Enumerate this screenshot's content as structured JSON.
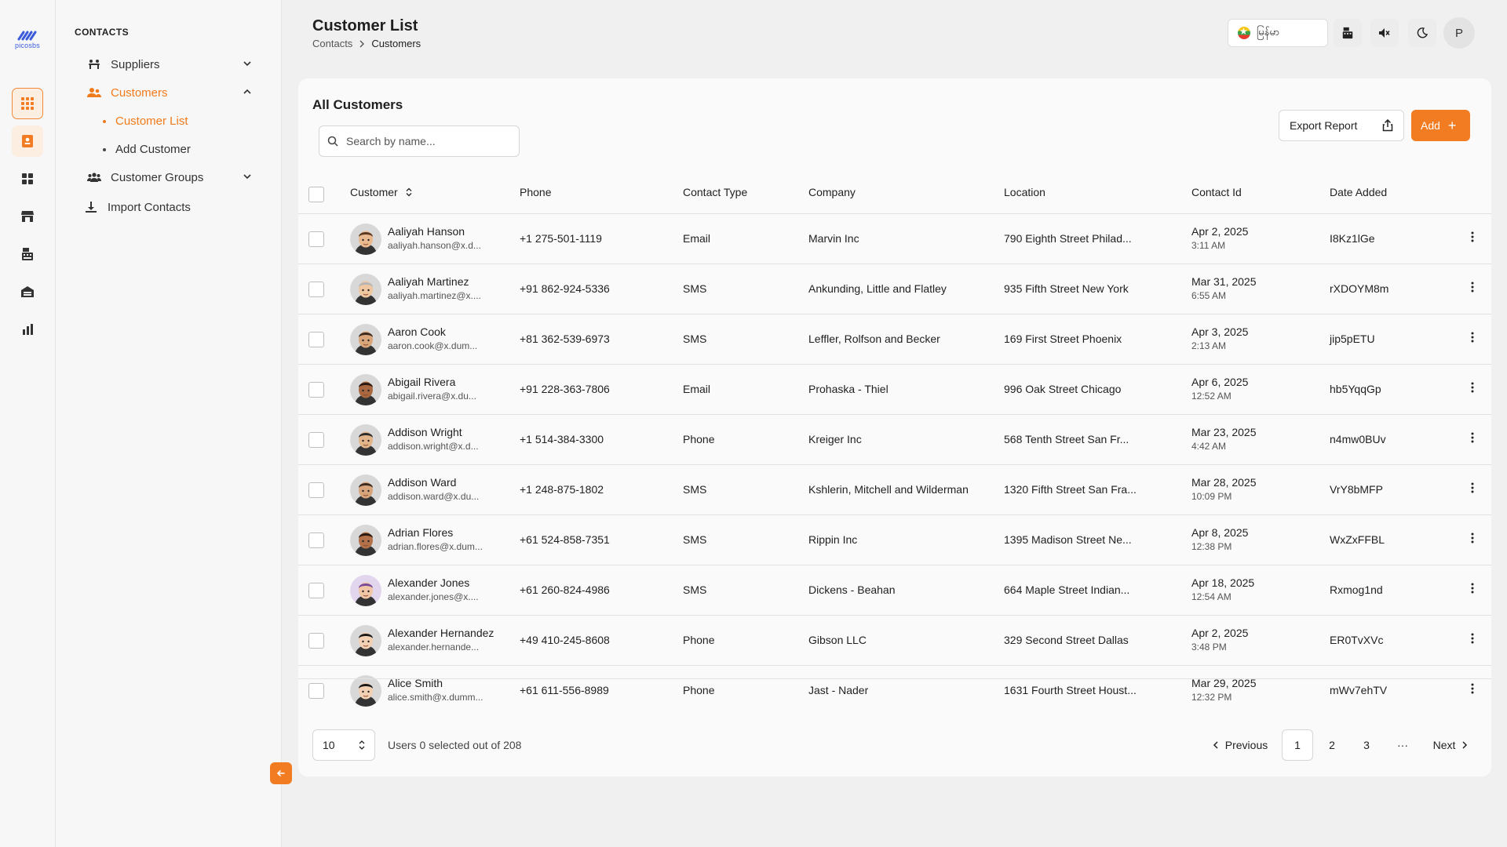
{
  "brand": {
    "logo_text": "picosbs"
  },
  "rail": {
    "items": [
      {
        "name": "grid",
        "icon": "grid-icon"
      },
      {
        "name": "contacts",
        "icon": "contact-card-icon"
      },
      {
        "name": "widgets",
        "icon": "widgets-icon"
      },
      {
        "name": "store",
        "icon": "store-icon"
      },
      {
        "name": "cash-register",
        "icon": "cash-register-icon"
      },
      {
        "name": "warehouse",
        "icon": "warehouse-icon"
      },
      {
        "name": "reports",
        "icon": "bar-chart-icon"
      }
    ]
  },
  "sidebar": {
    "section_title": "CONTACTS",
    "items": [
      {
        "label": "Suppliers",
        "icon": "suppliers-icon",
        "expanded": false
      },
      {
        "label": "Customers",
        "icon": "customers-icon",
        "expanded": true,
        "active": true
      },
      {
        "label": "Customer Groups",
        "icon": "customer-groups-icon",
        "expanded": false
      },
      {
        "label": "Import Contacts",
        "icon": "download-icon"
      }
    ],
    "customers_sub": [
      {
        "label": "Customer List",
        "active": true
      },
      {
        "label": "Add Customer"
      }
    ]
  },
  "header": {
    "title": "Customer List",
    "breadcrumb": [
      "Contacts",
      "Customers"
    ],
    "language": "မြန်မာ",
    "avatar_initial": "P"
  },
  "card": {
    "title": "All Customers",
    "search_placeholder": "Search by name...",
    "export_label": "Export Report",
    "add_label": "Add",
    "columns": [
      "Customer",
      "Phone",
      "Contact Type",
      "Company",
      "Location",
      "Contact Id",
      "Date Added"
    ]
  },
  "rows": [
    {
      "name": "Aaliyah Hanson",
      "email": "aaliyah.hanson@x.d...",
      "phone": "+1 275-501-1119",
      "type": "Email",
      "company": "Marvin Inc",
      "location": "790 Eighth Street Philad...",
      "date": "Apr 2, 2025",
      "time": "3:11 AM",
      "id": "I8Kz1lGe",
      "avatar_bg": "#d8d8d8",
      "skin": "#e9b98f",
      "hair": "#5a3a22"
    },
    {
      "name": "Aaliyah Martinez",
      "email": "aaliyah.martinez@x....",
      "phone": "+91 862-924-5336",
      "type": "SMS",
      "company": "Ankunding, Little and Flatley",
      "location": "935 Fifth Street New York",
      "date": "Mar 31, 2025",
      "time": "6:55 AM",
      "id": "rXDOYM8m",
      "avatar_bg": "#d8d8d8",
      "skin": "#efc7a0",
      "hair": "#b5b5b5"
    },
    {
      "name": "Aaron Cook",
      "email": "aaron.cook@x.dum...",
      "phone": "+81 362-539-6973",
      "type": "SMS",
      "company": "Leffler, Rolfson and Becker",
      "location": "169 First Street Phoenix",
      "date": "Apr 3, 2025",
      "time": "2:13 AM",
      "id": "jip5pETU",
      "avatar_bg": "#d8d8d8",
      "skin": "#d9a57a",
      "hair": "#3a2a20"
    },
    {
      "name": "Abigail Rivera",
      "email": "abigail.rivera@x.du...",
      "phone": "+91 228-363-7806",
      "type": "Email",
      "company": "Prohaska - Thiel",
      "location": "996 Oak Street Chicago",
      "date": "Apr 6, 2025",
      "time": "12:52 AM",
      "id": "hb5YqqGp",
      "avatar_bg": "#d8d8d8",
      "skin": "#a8673e",
      "hair": "#2a1a12"
    },
    {
      "name": "Addison Wright",
      "email": "addison.wright@x.d...",
      "phone": "+1 514-384-3300",
      "type": "Phone",
      "company": "Kreiger Inc",
      "location": "568 Tenth Street San Fr...",
      "date": "Mar 23, 2025",
      "time": "4:42 AM",
      "id": "n4mw0BUv",
      "avatar_bg": "#d8d8d8",
      "skin": "#e2b48a",
      "hair": "#2c2c2c"
    },
    {
      "name": "Addison Ward",
      "email": "addison.ward@x.du...",
      "phone": "+1 248-875-1802",
      "type": "SMS",
      "company": "Kshlerin, Mitchell and Wilderman",
      "location": "1320 Fifth Street San Fra...",
      "date": "Mar 28, 2025",
      "time": "10:09 PM",
      "id": "VrY8bMFP",
      "avatar_bg": "#d8d8d8",
      "skin": "#d8a47c",
      "hair": "#3b2b22"
    },
    {
      "name": "Adrian Flores",
      "email": "adrian.flores@x.dum...",
      "phone": "+61 524-858-7351",
      "type": "SMS",
      "company": "Rippin Inc",
      "location": "1395 Madison Street Ne...",
      "date": "Apr 8, 2025",
      "time": "12:38 PM",
      "id": "WxZxFFBL",
      "avatar_bg": "#d8d8d8",
      "skin": "#b27148",
      "hair": "#2a1a12"
    },
    {
      "name": "Alexander Jones",
      "email": "alexander.jones@x....",
      "phone": "+61 260-824-4986",
      "type": "SMS",
      "company": "Dickens - Beahan",
      "location": "664 Maple Street Indian...",
      "date": "Apr 18, 2025",
      "time": "12:54 AM",
      "id": "Rxmog1nd",
      "avatar_bg": "#e2d6ee",
      "skin": "#f0c6a6",
      "hair": "#7a4a9a"
    },
    {
      "name": "Alexander Hernandez",
      "email": "alexander.hernande...",
      "phone": "+49 410-245-8608",
      "type": "Phone",
      "company": "Gibson LLC",
      "location": "329 Second Street Dallas",
      "date": "Apr 2, 2025",
      "time": "3:48 PM",
      "id": "ER0TvXVc",
      "avatar_bg": "#d8d8d8",
      "skin": "#f2d0b4",
      "hair": "#1a1a1a"
    },
    {
      "name": "Alice Smith",
      "email": "alice.smith@x.dumm...",
      "phone": "+61 611-556-8989",
      "type": "Phone",
      "company": "Jast - Nader",
      "location": "1631 Fourth Street Houst...",
      "date": "Mar 29, 2025",
      "time": "12:32 PM",
      "id": "mWv7ehTV",
      "avatar_bg": "#d8d8d8",
      "skin": "#f2d0b4",
      "hair": "#1a1a1a"
    }
  ],
  "footer": {
    "page_size": "10",
    "selection_text": "Users 0 selected out of 208",
    "previous_label": "Previous",
    "pages": [
      "1",
      "2",
      "3"
    ],
    "ellipsis": "···",
    "next_label": "Next",
    "current_page": "1"
  },
  "colors": {
    "accent": "#f27c22",
    "brand": "#3b5bdb"
  }
}
